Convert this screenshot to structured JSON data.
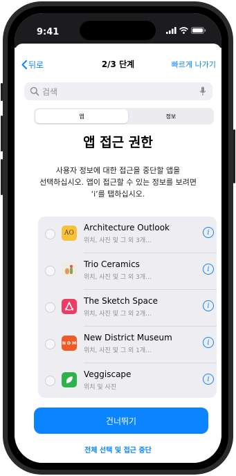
{
  "status_bar": {
    "time": "9:41",
    "icons": [
      "signal-icon",
      "wifi-icon",
      "battery-icon"
    ]
  },
  "nav": {
    "back_label": "뒤로",
    "title": "2/3 단계",
    "skip_label": "빠르게 나가기"
  },
  "search": {
    "placeholder": "검색",
    "value": ""
  },
  "segments": {
    "apps": "앱",
    "info": "정보",
    "selected": "apps"
  },
  "heading": "앱 접근 권한",
  "description": {
    "line1": "사용자 정보에 대한 접근을 중단할 앱을",
    "line2": "선택하십시오. 앱이 접근할 수 있는 정보를 보려면",
    "line3": "‘i’를 탭하십시오."
  },
  "apps": [
    {
      "name": "Architecture Outlook",
      "detail": "위치, 사진 및 그 외 3개...",
      "icon_text": "AO",
      "icon_color": "#f5c23a",
      "selected": false
    },
    {
      "name": "Trio Ceramics",
      "detail": "위치, 사진 및 그 외 3개...",
      "icon_text": "",
      "icon_color": "#f1ece0",
      "selected": false
    },
    {
      "name": "The Sketch Space",
      "detail": "위치, 사진 및 그 외 2개...",
      "icon_text": "",
      "icon_color": "#ee3b62",
      "selected": false
    },
    {
      "name": "New District Museum",
      "detail": "위치, 사진 및 그 외 1개...",
      "icon_text": "N D M",
      "icon_color": "#f05a28",
      "selected": false
    },
    {
      "name": "Veggiscape",
      "detail": "위치 및 사진",
      "icon_text": "",
      "icon_color": "#2eb24b",
      "selected": false
    }
  ],
  "buttons": {
    "skip": "건너뛰기",
    "select_all": "전체 선택 및 접근 중단"
  },
  "colors": {
    "accent": "#0a84ff",
    "status_bar_bg": "#1c1c1e"
  }
}
